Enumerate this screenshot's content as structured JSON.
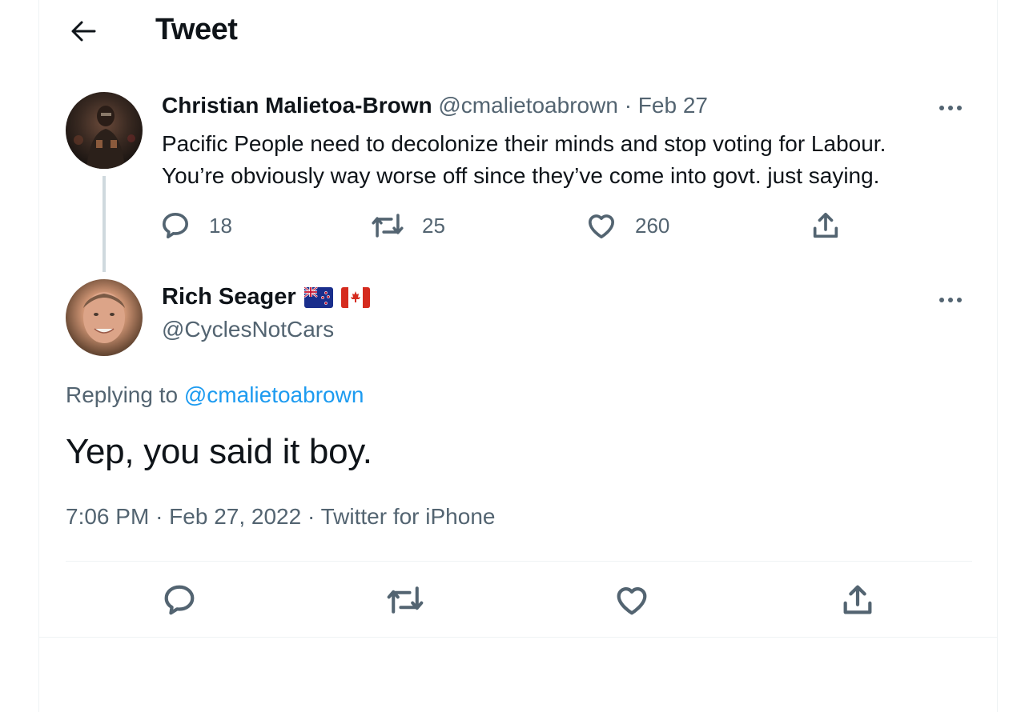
{
  "header": {
    "title": "Tweet"
  },
  "quoted_tweet": {
    "author_name": "Christian Malietoa-Brown",
    "handle": "@cmalietoabrown",
    "separator": "·",
    "date": "Feb 27",
    "text_line1": "Pacific People need to decolonize their minds and stop voting for Labour.",
    "text_line2": "You’re obviously way worse off since they’ve come into govt. just saying.",
    "replies": "18",
    "retweets": "25",
    "likes": "260"
  },
  "main_tweet": {
    "author_name": "Rich Seager",
    "handle": "@CyclesNotCars",
    "replying_prefix": "Replying to",
    "replying_handle": "@cmalietoabrown",
    "text": "Yep, you said it boy.",
    "time": "7:06 PM",
    "date": "Feb 27, 2022",
    "source": "Twitter for iPhone",
    "separator": "·"
  },
  "colors": {
    "accent": "#1d9bf0",
    "muted": "#536471",
    "divider": "#eff3f4"
  }
}
